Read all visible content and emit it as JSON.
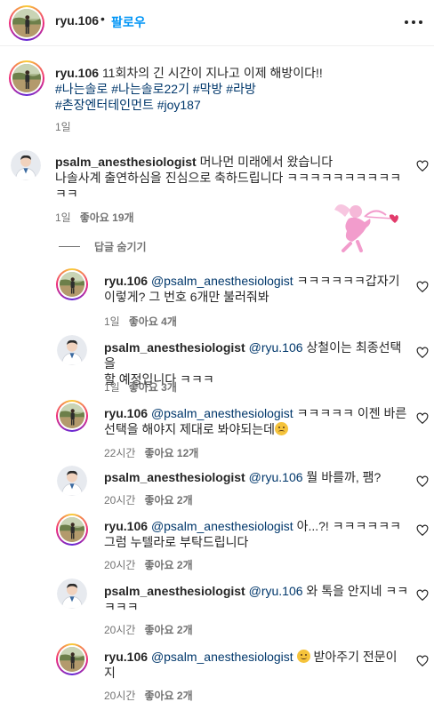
{
  "post": {
    "username": "ryu.106",
    "separator": "•",
    "follow_label": "팔로우",
    "more_icon": "more-horizontal-icon"
  },
  "caption": {
    "username": "ryu.106",
    "text": "11회차의 긴 시간이 지나고 이제 해방이다!!",
    "hashtags_line1": "#나는솔로 #나는솔로22기 #막방 #라방",
    "hashtags_line2": "#촌장엔터테인먼트 #joy187",
    "time": "1일"
  },
  "comments": [
    {
      "username": "psalm_anesthesiologist",
      "text_line1": "머나먼 미래에서 왔습니다",
      "text_line2": "나솔사계 출연하심을 진심으로 축하드립니다 ㅋㅋㅋㅋㅋㅋㅋㅋㅋㅋ",
      "text_line3": "ㅋㅋ",
      "time": "1일",
      "likes": "좋아요 19개"
    }
  ],
  "hide_replies_label": "답글 숨기기",
  "replies": [
    {
      "username": "ryu.106",
      "mention": "@psalm_anesthesiologist",
      "text_a": "ㅋㅋㅋㅋㅋㅋ갑자기",
      "text_b": "이렇게? 그 번호 6개만 불러줘봐",
      "time": "1일",
      "likes": "좋아요 4개"
    },
    {
      "username": "psalm_anesthesiologist",
      "mention": "@ryu.106",
      "text_a": "상철이는 최종선택을",
      "text_b": "할 예정입니다 ㅋㅋㅋ",
      "time": "1일",
      "likes": "좋아요 3개"
    },
    {
      "username": "ryu.106",
      "mention": "@psalm_anesthesiologist",
      "text_a": "ㅋㅋㅋㅋㅋ 이젠 바른",
      "text_b": "선택을 해야지 제대로 봐야되는데",
      "time": "22시간",
      "likes": "좋아요 12개"
    },
    {
      "username": "psalm_anesthesiologist",
      "mention": "@ryu.106",
      "text_a": "뭘 바를까, 팸?",
      "text_b": "",
      "time": "20시간",
      "likes": "좋아요 2개"
    },
    {
      "username": "ryu.106",
      "mention": "@psalm_anesthesiologist",
      "text_a": "아...?! ㅋㅋㅋㅋㅋㅋ",
      "text_b": "그럼 누텔라로 부탁드립니다",
      "time": "20시간",
      "likes": "좋아요 2개"
    },
    {
      "username": "psalm_anesthesiologist",
      "mention": "@ryu.106",
      "text_a": "와 톡을 안지네 ㅋㅋ",
      "text_b": "ㅋㅋㅋ",
      "time": "20시간",
      "likes": "좋아요 2개"
    },
    {
      "username": "ryu.106",
      "mention": "@psalm_anesthesiologist",
      "text_a": "받아주기 전문이",
      "text_b": "지",
      "time": "20시간",
      "likes": "좋아요 2개"
    }
  ]
}
